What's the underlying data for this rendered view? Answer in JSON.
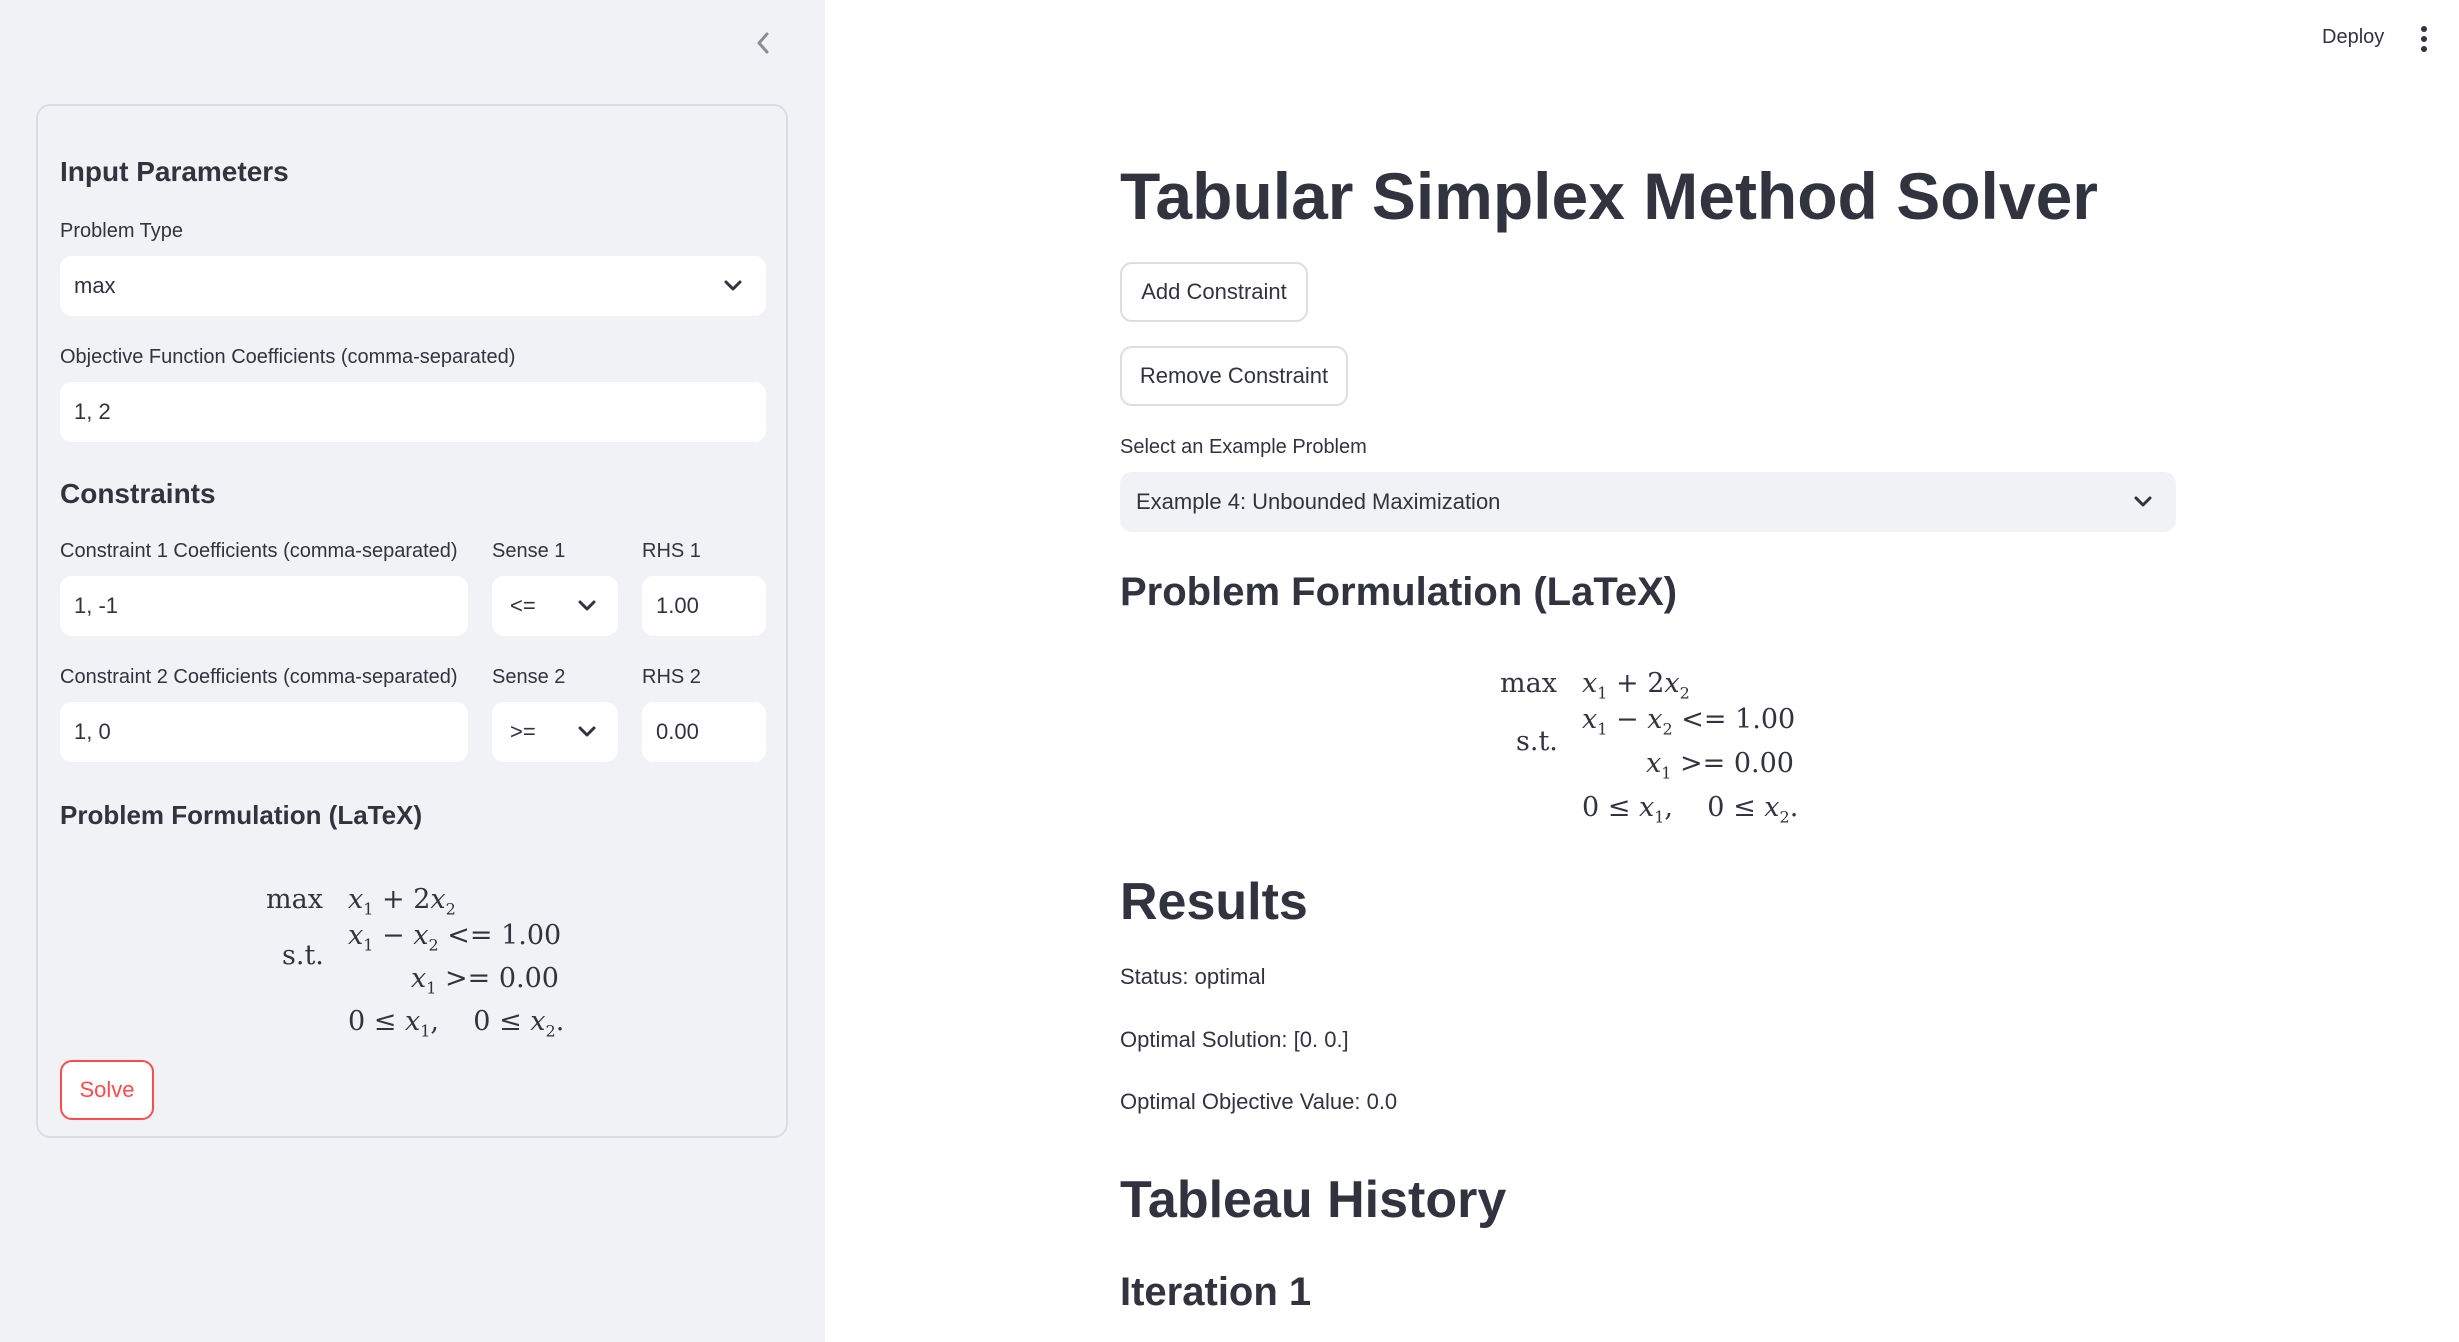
{
  "header": {
    "deploy_label": "Deploy"
  },
  "sidebar": {
    "section_title": "Input Parameters",
    "problem_type": {
      "label": "Problem Type",
      "value": "max"
    },
    "objective": {
      "label": "Objective Function Coefficients (comma-separated)",
      "value": "1, 2"
    },
    "constraints_title": "Constraints",
    "constraints": [
      {
        "coef_label": "Constraint 1 Coefficients (comma-separated)",
        "coef_value": "1, -1",
        "sense_label": "Sense 1",
        "sense_value": "<=",
        "rhs_label": "RHS 1",
        "rhs_value": "1.00"
      },
      {
        "coef_label": "Constraint 2 Coefficients (comma-separated)",
        "coef_value": "1, 0",
        "sense_label": "Sense 2",
        "sense_value": ">=",
        "rhs_label": "RHS 2",
        "rhs_value": "0.00"
      }
    ],
    "formulation_title": "Problem Formulation (LaTeX)",
    "solve_label": "Solve"
  },
  "formulation": {
    "max_word": "max",
    "st_word": "s.t.",
    "rhs1": "1.00",
    "rhs2": "0.00"
  },
  "main": {
    "title": "Tabular Simplex Method Solver",
    "add_constraint_label": "Add Constraint",
    "remove_constraint_label": "Remove Constraint",
    "example": {
      "label": "Select an Example Problem",
      "value": "Example 4: Unbounded Maximization"
    },
    "formulation_title": "Problem Formulation (LaTeX)",
    "results_title": "Results",
    "status": "Status: optimal",
    "solution": "Optimal Solution: [0. 0.]",
    "objective_value": "Optimal Objective Value: 0.0",
    "tableau_title": "Tableau History",
    "iteration_title": "Iteration 1"
  },
  "colors": {
    "accent": "#ff4b4b",
    "sidebar_bg": "#f0f2f6",
    "text": "#31333f"
  },
  "icons": {
    "collapse": "chevron-left-icon",
    "menu": "vertical-dots-icon",
    "dropdown": "chevron-down-icon"
  }
}
